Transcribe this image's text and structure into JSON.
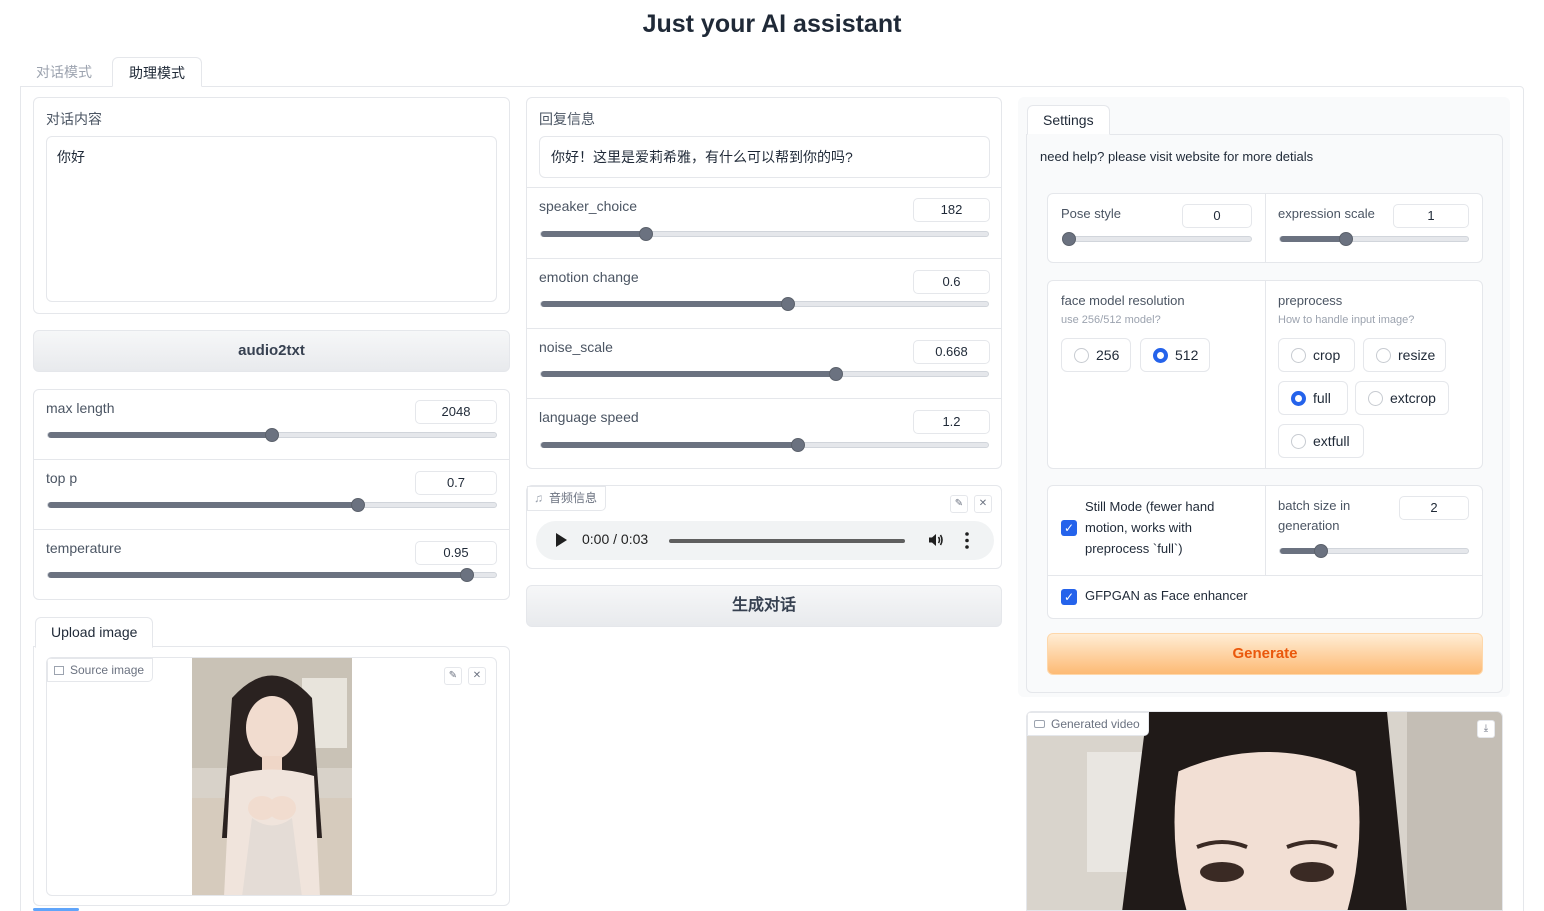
{
  "title": "Just your AI assistant",
  "tabs": [
    {
      "label": "对话模式"
    },
    {
      "label": "助理模式"
    }
  ],
  "left": {
    "input_label": "对话内容",
    "input_value": "你好",
    "audio2txt_label": "audio2txt",
    "sliders": [
      {
        "label": "max length",
        "value": "2048",
        "fraction": 0.5
      },
      {
        "label": "top p",
        "value": "0.7",
        "fraction": 0.693
      },
      {
        "label": "temperature",
        "value": "0.95",
        "fraction": 0.935
      }
    ],
    "upload_tab": "Upload image",
    "source_badge": "Source image"
  },
  "middle": {
    "reply_label": "回复信息",
    "reply_value": "你好！这里是爱莉希雅，有什么可以帮到你的吗?",
    "sliders": [
      {
        "label": "speaker_choice",
        "value": "182",
        "fraction": 0.235
      },
      {
        "label": "emotion change",
        "value": "0.6",
        "fraction": 0.553
      },
      {
        "label": "noise_scale",
        "value": "0.668",
        "fraction": 0.66
      },
      {
        "label": "language speed",
        "value": "1.2",
        "fraction": 0.575
      }
    ],
    "audio_badge": "音频信息",
    "audio_time": "0:00 / 0:03",
    "audio_progress": 0,
    "generate_dialog": "生成对话"
  },
  "right": {
    "settings_tab": "Settings",
    "help_text": "need help? please visit website for more detials",
    "pose_style": {
      "label": "Pose style",
      "value": "0",
      "fraction": 0.0
    },
    "expression_scale": {
      "label": "expression scale",
      "value": "1",
      "fraction": 0.35
    },
    "face_res": {
      "label": "face model resolution",
      "info": "use 256/512 model?",
      "options": [
        "256",
        "512"
      ],
      "selected": "512"
    },
    "preprocess": {
      "label": "preprocess",
      "info": "How to handle input image?",
      "options": [
        "crop",
        "resize",
        "full",
        "extcrop",
        "extfull"
      ],
      "selected": "full"
    },
    "still_mode": {
      "label": "Still Mode (fewer hand motion, works with preprocess `full`)",
      "checked": true
    },
    "batch_size": {
      "label": "batch size in generation",
      "value": "2",
      "fraction": 0.22
    },
    "gfpgan": {
      "label": "GFPGAN as Face enhancer",
      "checked": true
    },
    "generate": "Generate",
    "video_badge": "Generated video"
  },
  "colors": {
    "accent": "#2563eb",
    "generate_bg": "#fed7aa",
    "generate_text": "#ea580c"
  }
}
